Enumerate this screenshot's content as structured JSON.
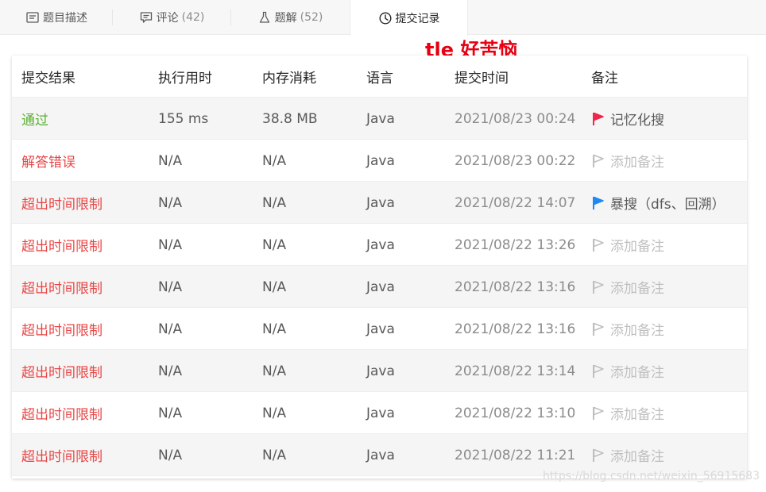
{
  "tabs": [
    {
      "label": "题目描述",
      "count": "",
      "icon": "document-icon"
    },
    {
      "label": "评论",
      "count": "(42)",
      "icon": "comment-icon"
    },
    {
      "label": "题解",
      "count": "(52)",
      "icon": "flask-icon"
    },
    {
      "label": "提交记录",
      "count": "",
      "icon": "clock-icon"
    }
  ],
  "annotation": "tle 好苦恼",
  "table": {
    "headers": {
      "result": "提交结果",
      "time": "执行用时",
      "memory": "内存消耗",
      "language": "语言",
      "submitted": "提交时间",
      "note": "备注"
    },
    "rows": [
      {
        "result": "通过",
        "status": "pass",
        "time": "155 ms",
        "memory": "38.8 MB",
        "language": "Java",
        "submitted": "2021/08/23 00:24",
        "note": "记忆化搜",
        "flag": "red"
      },
      {
        "result": "解答错误",
        "status": "fail",
        "time": "N/A",
        "memory": "N/A",
        "language": "Java",
        "submitted": "2021/08/23 00:22",
        "note": "添加备注",
        "flag": "none"
      },
      {
        "result": "超出时间限制",
        "status": "fail",
        "time": "N/A",
        "memory": "N/A",
        "language": "Java",
        "submitted": "2021/08/22 14:07",
        "note": "暴搜（dfs、回溯）",
        "flag": "blue"
      },
      {
        "result": "超出时间限制",
        "status": "fail",
        "time": "N/A",
        "memory": "N/A",
        "language": "Java",
        "submitted": "2021/08/22 13:26",
        "note": "添加备注",
        "flag": "none"
      },
      {
        "result": "超出时间限制",
        "status": "fail",
        "time": "N/A",
        "memory": "N/A",
        "language": "Java",
        "submitted": "2021/08/22 13:16",
        "note": "添加备注",
        "flag": "none"
      },
      {
        "result": "超出时间限制",
        "status": "fail",
        "time": "N/A",
        "memory": "N/A",
        "language": "Java",
        "submitted": "2021/08/22 13:16",
        "note": "添加备注",
        "flag": "none"
      },
      {
        "result": "超出时间限制",
        "status": "fail",
        "time": "N/A",
        "memory": "N/A",
        "language": "Java",
        "submitted": "2021/08/22 13:14",
        "note": "添加备注",
        "flag": "none"
      },
      {
        "result": "超出时间限制",
        "status": "fail",
        "time": "N/A",
        "memory": "N/A",
        "language": "Java",
        "submitted": "2021/08/22 13:10",
        "note": "添加备注",
        "flag": "none"
      },
      {
        "result": "超出时间限制",
        "status": "fail",
        "time": "N/A",
        "memory": "N/A",
        "language": "Java",
        "submitted": "2021/08/22 11:21",
        "note": "添加备注",
        "flag": "none"
      }
    ]
  },
  "watermark": "https://blog.csdn.net/weixin_56915683",
  "colors": {
    "pass": "#5cb033",
    "fail": "#e84646",
    "flag_red": "#f0264b",
    "flag_blue": "#1e88f5",
    "flag_none": "#bfbfbf",
    "annotation": "#e60012"
  }
}
